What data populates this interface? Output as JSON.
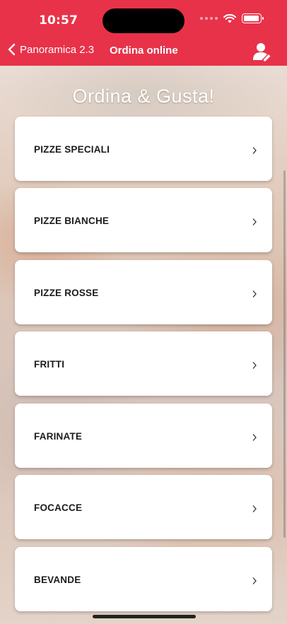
{
  "status_bar": {
    "time": "10:57"
  },
  "nav": {
    "back_label": "Panoramica 2.3",
    "title": "Ordina online",
    "user_icon": "user-icon"
  },
  "hero": {
    "title": "Ordina & Gusta!"
  },
  "categories": [
    {
      "label": "PIZZE SPECIALI"
    },
    {
      "label": "PIZZE BIANCHE"
    },
    {
      "label": "PIZZE ROSSE"
    },
    {
      "label": "FRITTI"
    },
    {
      "label": "FARINATE"
    },
    {
      "label": "FOCACCE"
    },
    {
      "label": "BEVANDE"
    }
  ],
  "colors": {
    "accent": "#e8324a"
  }
}
